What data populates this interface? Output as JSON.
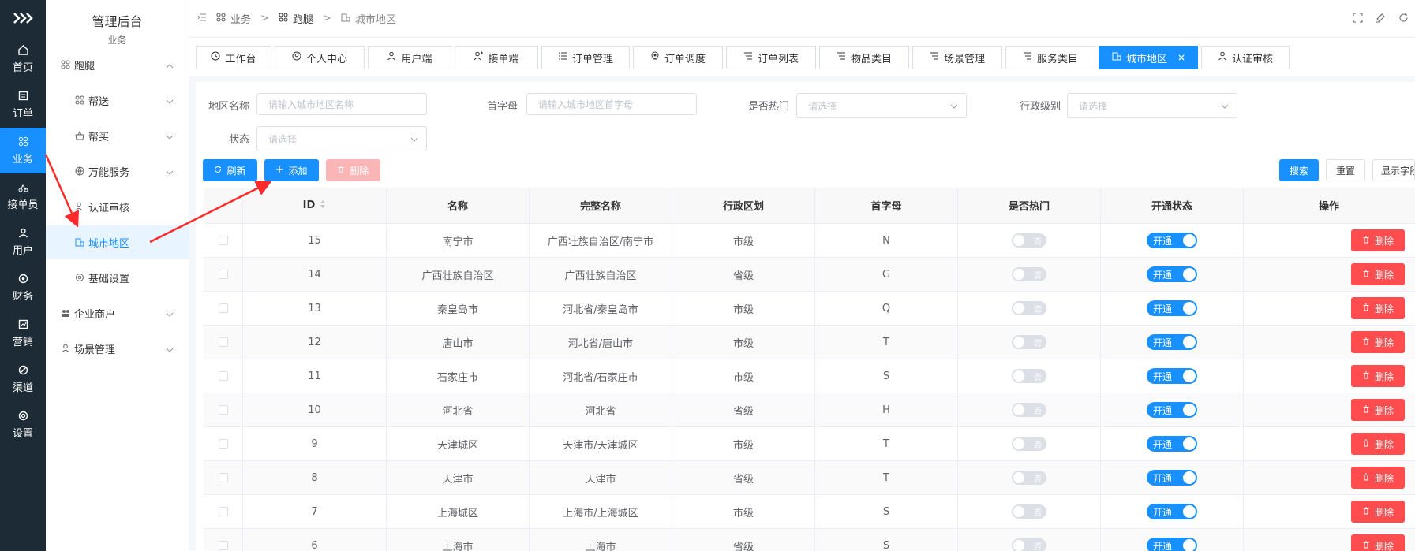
{
  "rail": {
    "items": [
      {
        "label": "首页",
        "icon": "home-icon"
      },
      {
        "label": "订单",
        "icon": "order-icon"
      },
      {
        "label": "业务",
        "icon": "business-icon"
      },
      {
        "label": "接单员",
        "icon": "courier-icon"
      },
      {
        "label": "用户",
        "icon": "user-icon"
      },
      {
        "label": "财务",
        "icon": "finance-icon"
      },
      {
        "label": "营销",
        "icon": "marketing-icon"
      },
      {
        "label": "渠道",
        "icon": "channel-icon"
      },
      {
        "label": "设置",
        "icon": "settings-icon"
      }
    ]
  },
  "submenu": {
    "title": "管理后台",
    "subtitle": "业务",
    "items": [
      {
        "label": "跑腿"
      },
      {
        "label": "帮送"
      },
      {
        "label": "帮买"
      },
      {
        "label": "万能服务"
      },
      {
        "label": "认证审核"
      },
      {
        "label": "城市地区"
      },
      {
        "label": "基础设置"
      },
      {
        "label": "企业商户"
      },
      {
        "label": "场景管理"
      }
    ]
  },
  "breadcrumb": {
    "items": [
      "业务",
      "跑腿",
      "城市地区"
    ]
  },
  "tabs": [
    {
      "label": "工作台"
    },
    {
      "label": "个人中心"
    },
    {
      "label": "用户端"
    },
    {
      "label": "接单端"
    },
    {
      "label": "订单管理"
    },
    {
      "label": "订单调度"
    },
    {
      "label": "订单列表"
    },
    {
      "label": "物品类目"
    },
    {
      "label": "场景管理"
    },
    {
      "label": "服务类目"
    },
    {
      "label": "城市地区"
    },
    {
      "label": "认证审核"
    }
  ],
  "filters": {
    "name_label": "地区名称",
    "name_placeholder": "请输入城市地区名称",
    "initial_label": "首字母",
    "initial_placeholder": "请输入城市地区首字母",
    "hot_label": "是否热门",
    "hot_placeholder": "请选择",
    "level_label": "行政级别",
    "level_placeholder": "请选择",
    "status_label": "状态",
    "status_placeholder": "请选择"
  },
  "actions": {
    "refresh": "刷新",
    "add": "添加",
    "delete": "删除",
    "search": "搜索",
    "reset": "重置",
    "show_fields": "显示字段"
  },
  "table": {
    "headers": [
      "ID",
      "名称",
      "完整名称",
      "行政区划",
      "首字母",
      "是否热门",
      "开通状态",
      "操作"
    ],
    "hot_off_text": "否",
    "open_on_text": "开通",
    "delete_text": "删除",
    "rows": [
      {
        "id": "15",
        "name": "南宁市",
        "full": "广西壮族自治区/南宁市",
        "level": "市级",
        "initial": "N"
      },
      {
        "id": "14",
        "name": "广西壮族自治区",
        "full": "广西壮族自治区",
        "level": "省级",
        "initial": "G"
      },
      {
        "id": "13",
        "name": "秦皇岛市",
        "full": "河北省/秦皇岛市",
        "level": "市级",
        "initial": "Q"
      },
      {
        "id": "12",
        "name": "唐山市",
        "full": "河北省/唐山市",
        "level": "市级",
        "initial": "T"
      },
      {
        "id": "11",
        "name": "石家庄市",
        "full": "河北省/石家庄市",
        "level": "市级",
        "initial": "S"
      },
      {
        "id": "10",
        "name": "河北省",
        "full": "河北省",
        "level": "省级",
        "initial": "H"
      },
      {
        "id": "9",
        "name": "天津城区",
        "full": "天津市/天津城区",
        "level": "市级",
        "initial": "T"
      },
      {
        "id": "8",
        "name": "天津市",
        "full": "天津市",
        "level": "省级",
        "initial": "T"
      },
      {
        "id": "7",
        "name": "上海城区",
        "full": "上海市/上海城区",
        "level": "市级",
        "initial": "S"
      },
      {
        "id": "6",
        "name": "上海市",
        "full": "上海市",
        "level": "省级",
        "initial": "S"
      }
    ]
  },
  "colors": {
    "primary": "#1890ff",
    "danger": "#ff4d4f",
    "rail_bg": "#1c2b36",
    "annotation": "#ff2a2a"
  }
}
